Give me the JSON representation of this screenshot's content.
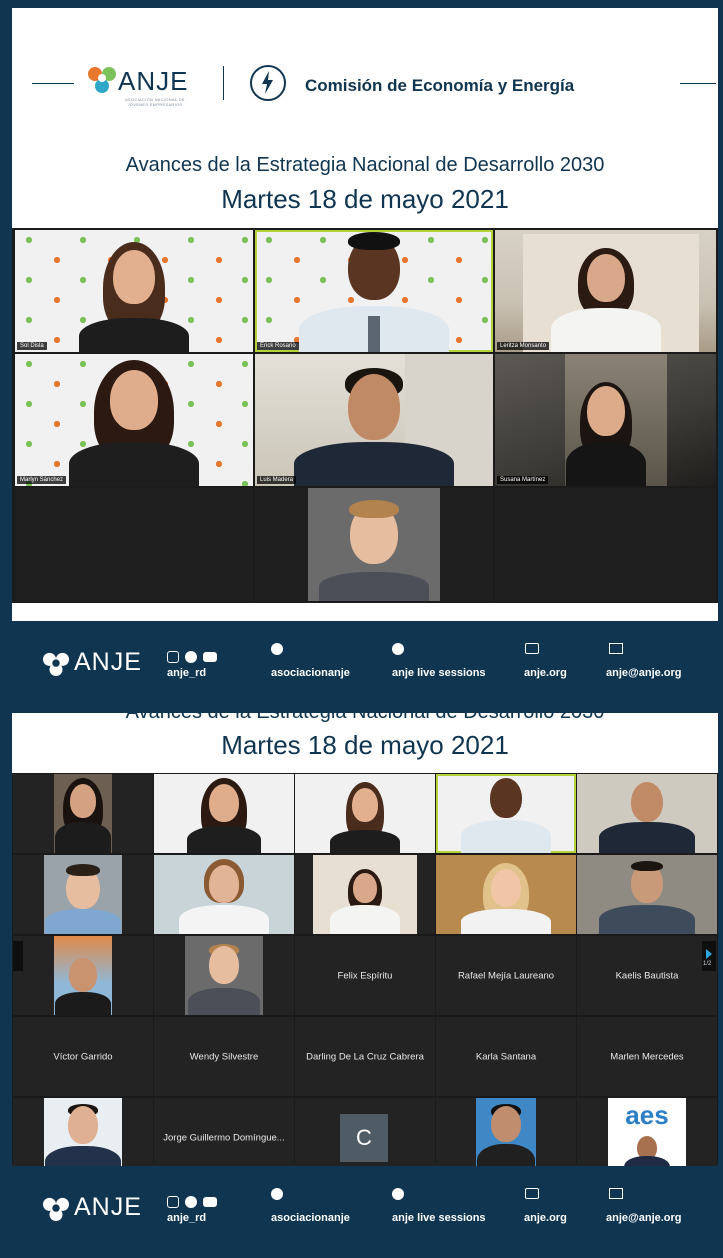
{
  "brand": {
    "anje": "ANJE",
    "anje_sub": "ASOCIACIÓN NACIONAL DE JÓVENES EMPRESARIOS",
    "commission": "Comisión de Economía y Energía"
  },
  "banner": {
    "headline": "Avances de la Estrategia Nacional de Desarrollo 2030",
    "date": "Martes 18 de mayo 2021"
  },
  "participants_top": [
    {
      "name": "Sol Disla"
    },
    {
      "name": "Erick Rosario"
    },
    {
      "name": "Leritza Monsanto"
    },
    {
      "name": "Marlyn Sánchez"
    },
    {
      "name": "Luis Madera"
    },
    {
      "name": "Susana Martínez"
    }
  ],
  "footer": {
    "instagram_handle": "anje_rd",
    "facebook_handle": "asociacionanje",
    "spotify_label": "anje live sessions",
    "website": "anje.org",
    "email": "anje@anje.org"
  },
  "gallery_names": {
    "r3c3": "Felix Espíritu",
    "r3c4": "Rafael Mejía Laureano",
    "r3c5": "Kaelis Bautista",
    "r4c1": "Víctor Garrido",
    "r4c2": "Wendy Silvestre",
    "r4c3": "Darling De La Cruz  Cabrera",
    "r4c4": "Karla Santana",
    "r4c5": "Marlen Mercedes",
    "r5c2": "Jorge Guillermo Domíngue...",
    "r5c3_initial": "C"
  },
  "pagination": "1/2",
  "colors": {
    "navy": "#0f3550",
    "active_speaker": "#b6d23a",
    "zoom_tile": "#232323"
  }
}
